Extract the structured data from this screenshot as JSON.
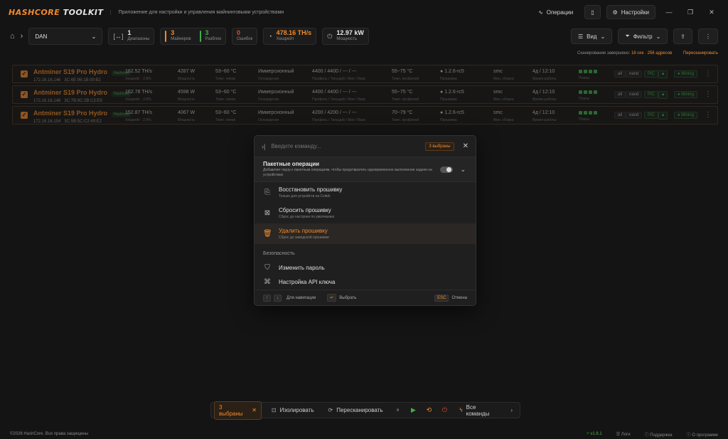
{
  "app": {
    "logo_part1": "HASHCORE",
    "logo_part2": "TOOLKIT",
    "subtitle": "Приложение для настройки и управления майнинговыми устройствами",
    "operations_label": "Операции",
    "settings_label": "Настройки"
  },
  "toolbar": {
    "device_group": "DAN",
    "stats": [
      {
        "value": "1",
        "label": "Диапазоны",
        "color": "#888888"
      },
      {
        "value": "3",
        "label": "Майнеров",
        "color": "#f28a2c"
      },
      {
        "value": "3",
        "label": "Разблок",
        "color": "#3fae4e"
      },
      {
        "value": "0",
        "label": "Ошибок",
        "color": "#e04a3a"
      }
    ],
    "hashrate": {
      "value": "478.16 TH/s",
      "label": "Хешрейт"
    },
    "power": {
      "value": "12.97 kW",
      "label": "Мощность"
    },
    "view_label": "Вид",
    "filter_label": "Фильтр"
  },
  "scan_status": {
    "prefix": "Сканирование завершено:",
    "highlight": "18 сек · 256 адресов",
    "rescan": "Пересканировать"
  },
  "devices": [
    {
      "name": "Antminer S19 Pro Hydro",
      "badge": "Hashcore",
      "ip": "172.16.16.146",
      "mac": "3C:6E:96:1B:09:B2",
      "hashrate": "162.52 TH/s",
      "hash_sub": "Хешрейт · 2.8%",
      "power": "4287 W",
      "power_sub": "Мощность",
      "temp": "53~60 °C",
      "temp_sub": "Темп. чипов",
      "cooling": "Иммерсионный",
      "cooling_sub": "Охлаждение",
      "fans": "4400 / 4400 / --- / ---",
      "fans_sub": "Профиль / Текущий / Мин / Макс",
      "range": "55~75 °C",
      "range_sub": "Темп. профилей",
      "fw": "1.2.6-rc5",
      "fw_sub": "Прошивка",
      "os": "smc",
      "os_sub": "Мин. сборка",
      "uptime": "4д / 12:10",
      "uptime_sub": "Время работы",
      "boards_sub": "Платы",
      "tag1": "all",
      "tag2": "nand",
      "tag3": "PIC",
      "status": "Mining"
    },
    {
      "name": "Antminer S19 Pro Hydro",
      "badge": "Hashcore",
      "ip": "172.16.16.148",
      "mac": "3C:7B:9C:2B:C3:E9",
      "hashrate": "162.78 TH/s",
      "hash_sub": "Хешрейт · 2.8%",
      "power": "4598 W",
      "power_sub": "Мощность",
      "temp": "53~60 °C",
      "temp_sub": "Темп. чипов",
      "cooling": "Иммерсионный",
      "cooling_sub": "Охлаждение",
      "fans": "4400 / 4400 / --- / ---",
      "fans_sub": "Профиль / Текущий / Мин / Макс",
      "range": "55~75 °C",
      "range_sub": "Темп. профилей",
      "fw": "1.2.6-rc5",
      "fw_sub": "Прошивка",
      "os": "smc",
      "os_sub": "Мин. сборка",
      "uptime": "4д / 12:10",
      "uptime_sub": "Время работы",
      "boards_sub": "Платы",
      "tag1": "all",
      "tag2": "nand",
      "tag3": "PIC",
      "status": "Mining"
    },
    {
      "name": "Antminer S19 Pro Hydro",
      "badge": "Hashcore",
      "ip": "172.16.16.154",
      "mac": "3C:5B:5C:C2:49:E2",
      "hashrate": "152.87 TH/s",
      "hash_sub": "Хешрейт · 2.8%",
      "power": "4067 W",
      "power_sub": "Мощность",
      "temp": "53~60 °C",
      "temp_sub": "Темп. чипов",
      "cooling": "Иммерсионный",
      "cooling_sub": "Охлаждение",
      "fans": "4200 / 4200 / --- / ---",
      "fans_sub": "Профиль / Текущий / Мин / Макс",
      "range": "70~79 °C",
      "range_sub": "Темп. профилей",
      "fw": "1.2.6-rc5",
      "fw_sub": "Прошивка",
      "os": "smc",
      "os_sub": "Мин. сборка",
      "uptime": "4д / 12:10",
      "uptime_sub": "Время работы",
      "boards_sub": "Платы",
      "tag1": "all",
      "tag2": "nand",
      "tag3": "PIC",
      "status": "Mining"
    }
  ],
  "palette": {
    "placeholder": "Введите команду...",
    "selected_badge": "3 выбраны",
    "batch_title": "Пакетные операции",
    "batch_desc": "Добавляет паузу к пакетным операциям, чтобы предотвратить одновременное выполнение задачи на устройствах",
    "items": [
      {
        "title": "Восстановить прошивку",
        "desc": "Только для устройств на Cvitek"
      },
      {
        "title": "Сбросить прошивку",
        "desc": "Сброс до настроек по умолчанию"
      },
      {
        "title": "Удалить прошивку",
        "desc": "Сброс до заводской прошивки"
      }
    ],
    "section": "Безопасность",
    "security_items": [
      {
        "title": "Изменить пароль"
      },
      {
        "title": "Настройка API ключа"
      }
    ],
    "footer": {
      "nav": "Для навигации",
      "select": "Выбрать",
      "esc_key": "ESC",
      "cancel": "Отмена"
    }
  },
  "actionbar": {
    "selected": "3 выбраны",
    "isolate": "Изолировать",
    "rescan": "Пересканировать",
    "all_commands": "Все команды"
  },
  "footer": {
    "copyright": "©2026 HashCore. Все права защищены",
    "version": "v1.6.1",
    "logs": "Логи",
    "support": "Поддержка",
    "about": "О программе"
  }
}
